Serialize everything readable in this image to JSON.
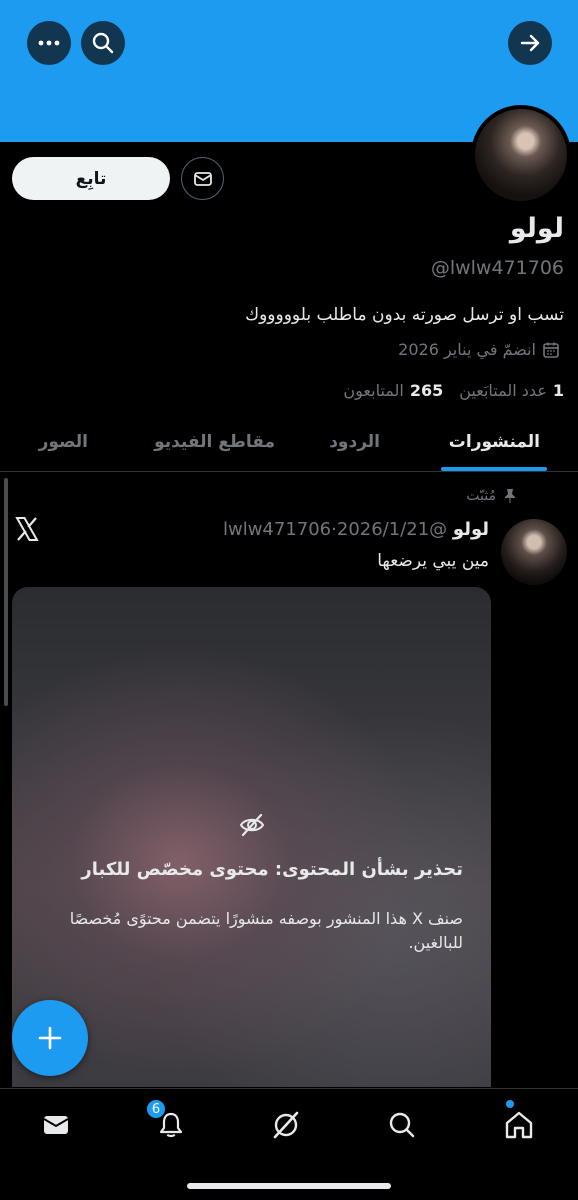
{
  "profile": {
    "name": "لولو",
    "handle": "@lwlw471706",
    "bio": "تسب او ترسل صورته بدون ماطلب بلوووووك",
    "joined": "انضمّ في يناير 2026",
    "following_count": "1",
    "following_label": "عدد المتابَعين",
    "followers_count": "265",
    "followers_label": "المتابعون"
  },
  "actions": {
    "follow_label": "تابِع"
  },
  "tabs": [
    {
      "label": "المنشورات",
      "active": true
    },
    {
      "label": "الردود",
      "active": false
    },
    {
      "label": "مقاطع الفيديو",
      "active": false
    },
    {
      "label": "الصور",
      "active": false
    }
  ],
  "post": {
    "pinned_label": "مُثبّت",
    "author": "لولو",
    "handle": "@lwlw471706",
    "separator": "·",
    "date": "2026/1/21",
    "text": "مين يبي يرضعها",
    "warning_title": "تحذير بشأن المحتوى: محتوى مخصّص للكبار",
    "warning_body": "صنف X هذا المنشور بوصفه منشورًا يتضمن محتوًى مُخصصًا للبالغين."
  },
  "nav": {
    "notifications_badge": "6"
  },
  "colors": {
    "accent": "#1d9bf0",
    "background": "#000000",
    "text": "#e7e9ea",
    "muted": "#71767b"
  },
  "icons": [
    "more-icon",
    "search-icon",
    "forward-arrow-icon",
    "mail-icon",
    "calendar-icon",
    "pin-icon",
    "x-logo-icon",
    "hidden-eye-icon",
    "plus-icon",
    "inbox-icon",
    "bell-icon",
    "grok-icon",
    "home-icon"
  ]
}
